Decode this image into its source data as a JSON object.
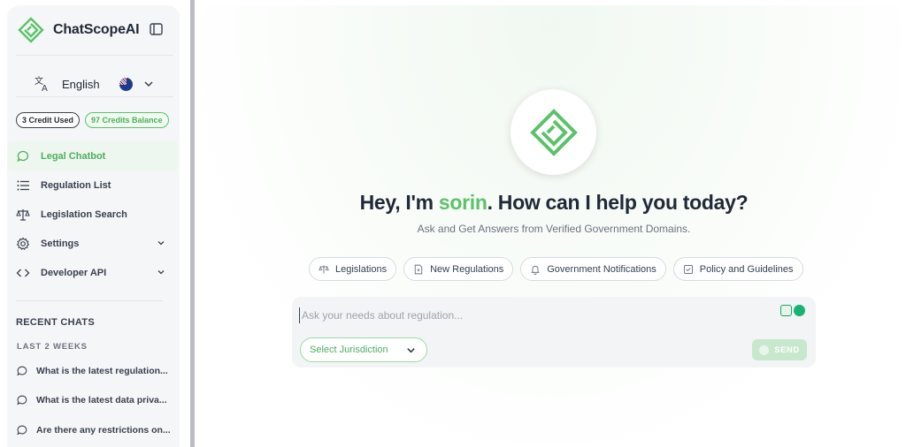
{
  "brand": {
    "name": "ChatScopeAI"
  },
  "language": {
    "label": "English"
  },
  "credits": {
    "used": "3 Credit Used",
    "balance": "97 Credits Balance"
  },
  "nav": [
    {
      "label": "Legal Chatbot",
      "icon": "chat-bubble-icon",
      "active": true
    },
    {
      "label": "Regulation List",
      "icon": "list-icon"
    },
    {
      "label": "Legislation Search",
      "icon": "scale-icon"
    },
    {
      "label": "Settings",
      "icon": "gear-icon",
      "expandable": true
    },
    {
      "label": "Developer API",
      "icon": "code-icon",
      "expandable": true
    }
  ],
  "recent": {
    "title": "RECENT CHATS",
    "period": "LAST 2 WEEKS",
    "items": [
      "What is the latest regulation...",
      "What is the latest data priva...",
      "Are there any restrictions on..."
    ]
  },
  "hero": {
    "greeting_prefix": "Hey, I'm ",
    "user_name": "sorin",
    "greeting_suffix": ". How can I help you today?",
    "subtitle": "Ask and Get Answers from Verified Government Domains."
  },
  "chips": [
    {
      "label": "Legislations",
      "icon": "scale-icon"
    },
    {
      "label": "New Regulations",
      "icon": "document-icon"
    },
    {
      "label": "Government Notifications",
      "icon": "bell-icon"
    },
    {
      "label": "Policy and Guidelines",
      "icon": "checkbox-doc-icon"
    }
  ],
  "composer": {
    "placeholder": "Ask your needs about regulation...",
    "jurisdiction_label": "Select Jurisdiction",
    "send_label": "SEND"
  },
  "colors": {
    "accent": "#5cc26a",
    "accent_soft": "#eef7ef"
  }
}
